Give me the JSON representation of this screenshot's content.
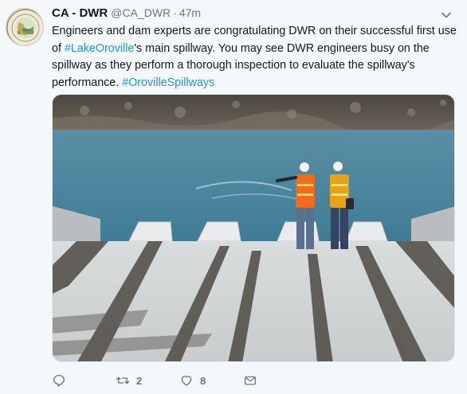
{
  "tweet": {
    "author_name": "CA - DWR",
    "author_handle": "@CA_DWR",
    "separator": "·",
    "time": "47m",
    "text_lines": [
      [
        {
          "t": "Engineers and dam experts are congratulating DWR on their successful first use",
          "link": false
        }
      ],
      [
        {
          "t": "of ",
          "link": false
        },
        {
          "t": "#LakeOroville",
          "link": true
        },
        {
          "t": "'s main spillway. You may see DWR engineers busy on the",
          "link": false
        }
      ],
      [
        {
          "t": "spillway as they perform a thorough inspection to evaluate the spillway's",
          "link": false
        }
      ],
      [
        {
          "t": "performance.  ",
          "link": false
        },
        {
          "t": "#OrovilleSpillways",
          "link": true
        }
      ]
    ],
    "replies_count": "",
    "retweets_count": "2",
    "likes_count": "8"
  },
  "icons": {
    "reply": "reply-icon",
    "retweet": "retweet-icon",
    "like": "heart-icon",
    "message": "envelope-icon",
    "menu": "chevron-down-icon"
  },
  "colors": {
    "link": "#1b95e0",
    "secondary_text": "#657786",
    "background": "#f5f8fa"
  }
}
